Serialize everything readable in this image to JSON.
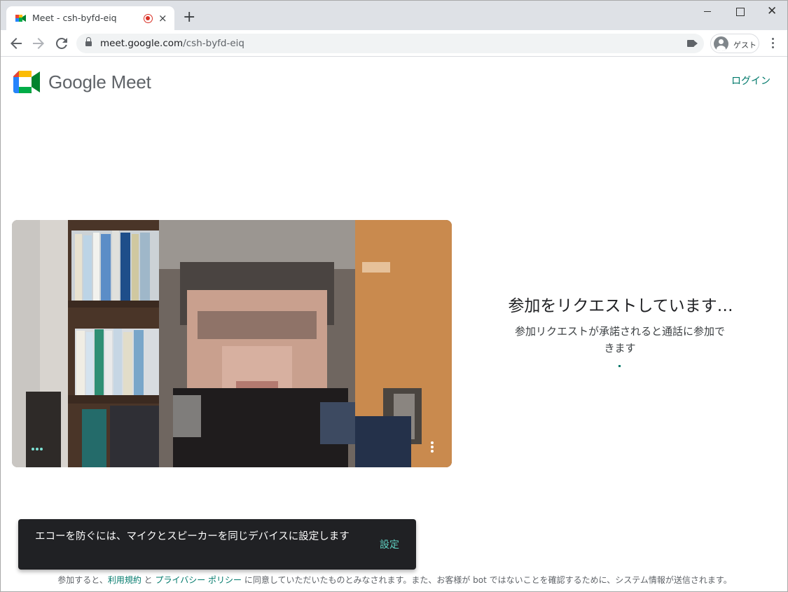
{
  "browser": {
    "tab_title": "Meet - csh-byfd-eiq",
    "tab_close_icon": "×",
    "new_tab_icon": "+",
    "url_host": "meet.google.com",
    "url_path": "/csh-byfd-eiq",
    "profile_label": "ゲスト",
    "close_glyph": "✕"
  },
  "header": {
    "brand": "Google Meet",
    "login_label": "ログイン"
  },
  "status": {
    "title": "参加をリクエストしています…",
    "subtitle": "参加リクエストが承諾されると通話に参加できます"
  },
  "snackbar": {
    "message": "エコーを防ぐには、マイクとスピーカーを同じデバイスに設定します",
    "action_label": "設定"
  },
  "footer": {
    "prefix": "参加すると、",
    "terms_link": "利用規約",
    "joiner": " と ",
    "privacy_link": "プライバシー ポリシー",
    "suffix": " に同意していただいたものとみなされます。また、お客様が bot ではないことを確認するために、システム情報が送信されます。"
  },
  "colors": {
    "accent": "#00796b",
    "snackbar_bg": "#202124",
    "snackbar_action": "#5fd1c2",
    "recording": "#d93025"
  },
  "icons": [
    "meet-logo-icon",
    "recording-icon",
    "close-icon",
    "new-tab-icon",
    "back-icon",
    "forward-icon",
    "reload-icon",
    "lock-icon",
    "camera-icon",
    "avatar-icon",
    "more-vert-icon",
    "more-horiz-icon"
  ]
}
